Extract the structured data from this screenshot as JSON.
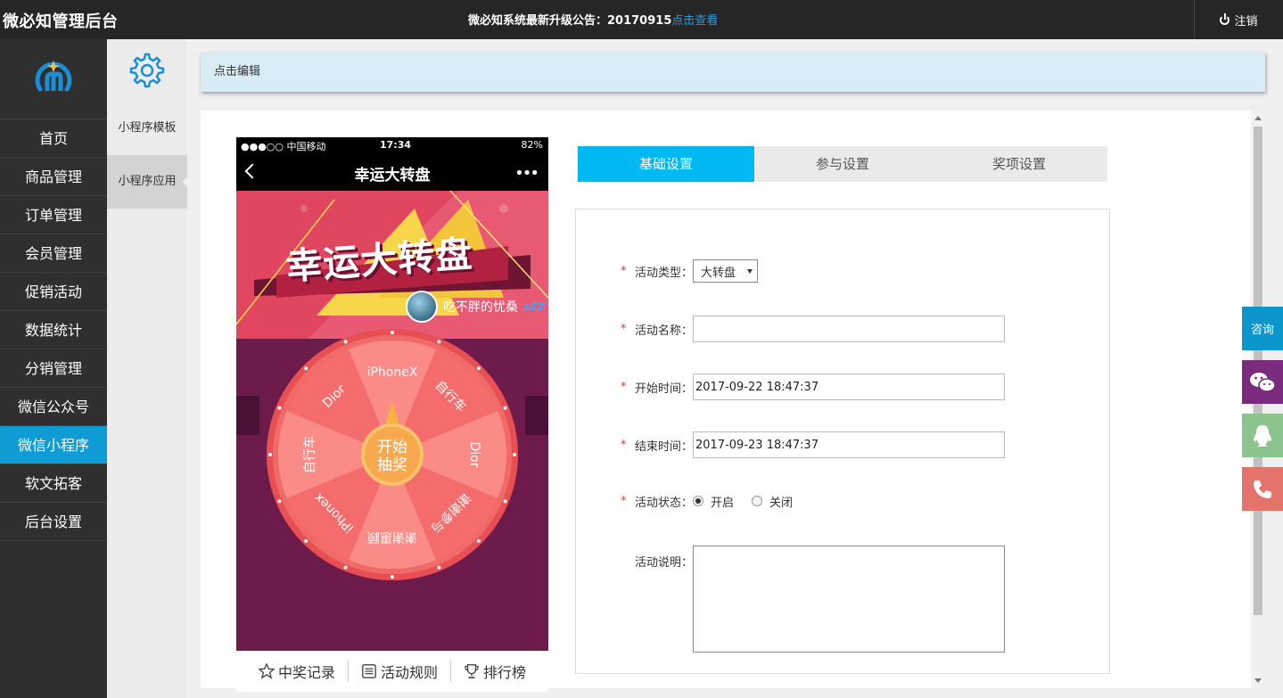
{
  "header": {
    "brand": "微必知管理后台",
    "notice_text": "微必知系统最新升级公告：20170915",
    "notice_link": "点击查看",
    "logout": "注销"
  },
  "sidebar": {
    "items": [
      {
        "label": "首页"
      },
      {
        "label": "商品管理"
      },
      {
        "label": "订单管理"
      },
      {
        "label": "会员管理"
      },
      {
        "label": "促销活动"
      },
      {
        "label": "数据统计"
      },
      {
        "label": "分销管理"
      },
      {
        "label": "微信公众号"
      },
      {
        "label": "微信小程序",
        "active": true
      },
      {
        "label": "软文拓客"
      },
      {
        "label": "后台设置"
      }
    ]
  },
  "subbar": {
    "items": [
      {
        "label": "小程序模板"
      },
      {
        "label": "小程序应用",
        "active": true
      }
    ]
  },
  "editbar": {
    "label": "点击编辑"
  },
  "phone": {
    "carrier": "●●●○○ 中国移动",
    "time": "17:34",
    "battery": "82%",
    "nav_title": "幸运大转盘",
    "banner_title": "幸运大转盘",
    "user_name": "吃不胖的忧桑",
    "zzz": "zZZ",
    "wheel_center": [
      "开始",
      "抽奖"
    ],
    "prizes": [
      "iPhoneX",
      "自行车",
      "Dior",
      "谢谢参与",
      "谢谢惠顾",
      "iPhonex",
      "自行车",
      "Dior"
    ],
    "bottom": {
      "records": "中奖记录",
      "rules": "活动规则",
      "rank": "排行榜"
    }
  },
  "tabs": [
    {
      "label": "基础设置",
      "active": true
    },
    {
      "label": "参与设置"
    },
    {
      "label": "奖项设置"
    }
  ],
  "form": {
    "type_label": "活动类型：",
    "type_value": "大转盘",
    "name_label": "活动名称：",
    "name_value": "",
    "start_label": "开始时间：",
    "start_value": "2017-09-22 18:47:37",
    "end_label": "结束时间：",
    "end_value": "2017-09-23 18:47:37",
    "status_label": "活动状态：",
    "status_on": "开启",
    "status_off": "关闭",
    "desc_label": "活动说明："
  },
  "float": {
    "consult": "咨询"
  },
  "colors": {
    "accent": "#0f9bd4",
    "tab_active": "#00b9f2",
    "required": "#ee3333"
  }
}
